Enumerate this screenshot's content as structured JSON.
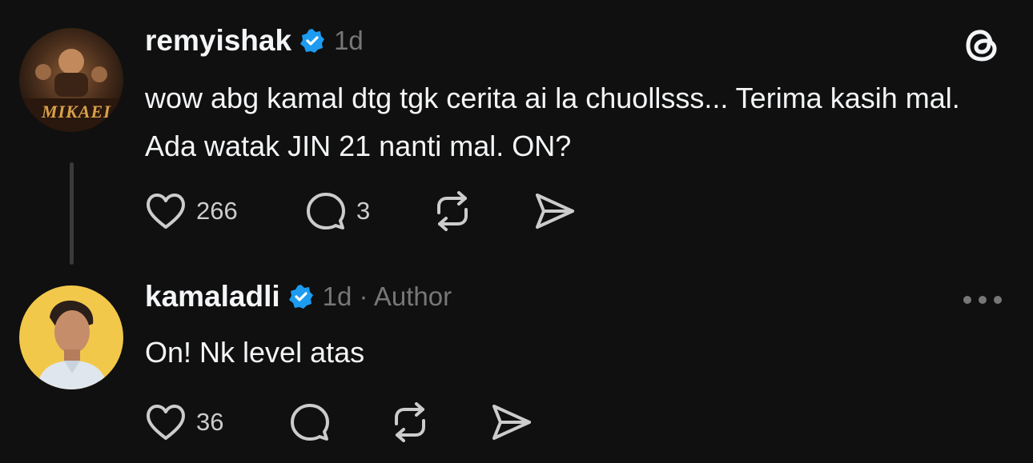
{
  "posts": [
    {
      "username": "remyishak",
      "verified": true,
      "meta": "1d",
      "text": "wow abg kamal dtg tgk cerita ai la chuollsss... Terima kasih mal. Ada watak JIN 21 nanti mal. ON?",
      "avatar_text": "MIKAEL",
      "actions": {
        "likes": "266",
        "replies": "3"
      }
    },
    {
      "username": "kamaladli",
      "verified": true,
      "meta": "1d · Author",
      "text": "On! Nk level atas",
      "actions": {
        "likes": "36"
      }
    }
  ],
  "icons": {
    "app_logo": "threads-logo-icon",
    "more": "more-horizontal-icon",
    "like": "heart-icon",
    "reply": "comment-bubble-icon",
    "repost": "repost-icon",
    "share": "share-send-icon",
    "verified": "verified-badge-icon"
  },
  "colors": {
    "background": "#101010",
    "text": "#f3f5f7",
    "muted": "#777777",
    "verified": "#1d9bf0",
    "avatar2_bg": "#f2c84b"
  }
}
